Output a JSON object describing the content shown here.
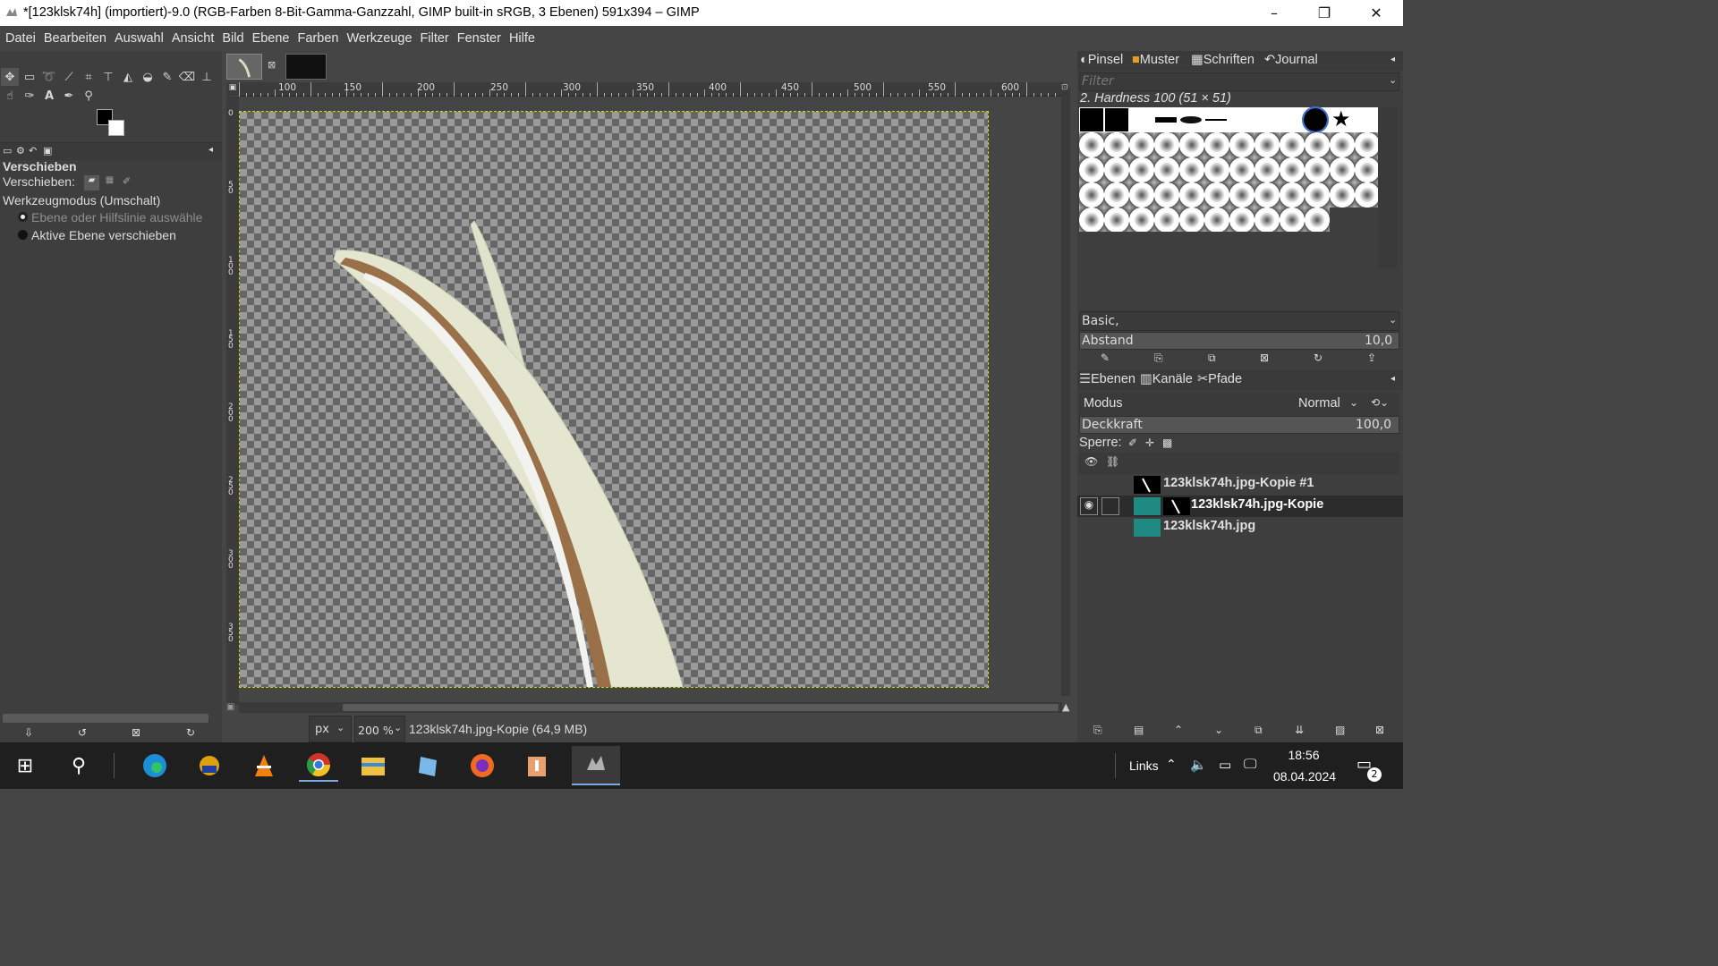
{
  "window": {
    "title": "*[123klsk74h] (importiert)-9.0 (RGB-Farben 8-Bit-Gamma-Ganzzahl, GIMP built-in sRGB, 3 Ebenen) 591x394 – GIMP",
    "minimize": "–",
    "maximize": "❐",
    "close": "✕"
  },
  "menu": [
    "Datei",
    "Bearbeiten",
    "Auswahl",
    "Ansicht",
    "Bild",
    "Ebene",
    "Farben",
    "Werkzeuge",
    "Filter",
    "Fenster",
    "Hilfe"
  ],
  "tool_options": {
    "title": "Verschieben",
    "move_label": "Verschieben:",
    "mode_label": "Werkzeugmodus (Umschalt)",
    "option1": "Ebene oder Hilfslinie auswähle",
    "option2": "Aktive Ebene verschieben"
  },
  "ruler": {
    "labels": [
      "100",
      "150",
      "200",
      "250",
      "300",
      "350",
      "400",
      "450",
      "500",
      "550",
      "600"
    ],
    "v_labels": [
      "0",
      "5 0",
      "1 0 0",
      "1 5 0",
      "2 0 0",
      "2 5 0",
      "3 0 0",
      "3 5 0"
    ]
  },
  "statusbar": {
    "unit": "px",
    "zoom": "200 %",
    "info": "123klsk74h.jpg-Kopie (64,9 MB)"
  },
  "brushes_panel": {
    "tabs": [
      "Pinsel",
      "Muster",
      "Schriften",
      "Journal"
    ],
    "filter_placeholder": "Filter",
    "current": "2. Hardness 100 (51 × 51)",
    "preset": "Basic,",
    "spacing_label": "Abstand",
    "spacing_value": "10,0"
  },
  "layers_panel": {
    "tabs": [
      "Ebenen",
      "Kanäle",
      "Pfade"
    ],
    "mode_label": "Modus",
    "mode_value": "Normal",
    "opacity_label": "Deckkraft",
    "opacity_value": "100,0",
    "lock_label": "Sperre:",
    "layers": [
      {
        "name": "123klsk74h.jpg-Kopie #1",
        "visible": false,
        "active": false
      },
      {
        "name": "123klsk74h.jpg-Kopie",
        "visible": true,
        "active": true
      },
      {
        "name": "123klsk74h.jpg",
        "visible": false,
        "active": false
      }
    ]
  },
  "taskbar": {
    "search_icon": "search-icon",
    "links": "Links",
    "time": "18:56",
    "date": "08.04.2024",
    "notifications": "2"
  }
}
